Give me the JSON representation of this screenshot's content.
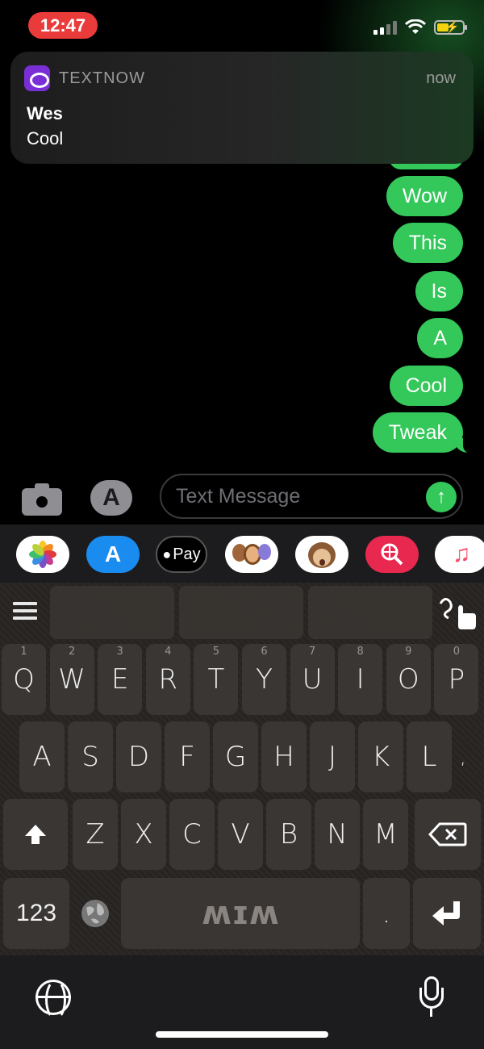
{
  "status_bar": {
    "time": "12:47"
  },
  "notification": {
    "app_name": "TEXTNOW",
    "time": "now",
    "title": "Wes",
    "body": "Cool",
    "app_icon_color": "#7a2fd6"
  },
  "messages": [
    {
      "text": "Wow"
    },
    {
      "text": "This"
    },
    {
      "text": "Is"
    },
    {
      "text": "A"
    },
    {
      "text": "Cool"
    },
    {
      "text": "Tweak"
    }
  ],
  "composer": {
    "placeholder": "Text Message",
    "send_icon": "arrow-up-icon",
    "accent_color": "#34c759"
  },
  "app_strip": [
    {
      "name": "photos-app",
      "label": "",
      "icon": "photos-flower-icon"
    },
    {
      "name": "app-store-app",
      "label": "",
      "icon": "app-store-icon"
    },
    {
      "name": "apple-pay-app",
      "label": "Pay",
      "icon": "apple-icon"
    },
    {
      "name": "memoji-stickers-app",
      "label": "",
      "icon": "memoji-icon"
    },
    {
      "name": "animoji-app",
      "label": "",
      "icon": "monkey-icon"
    },
    {
      "name": "images-search-app",
      "label": "",
      "icon": "globe-search-icon"
    },
    {
      "name": "music-app",
      "label": "",
      "icon": "music-note-icon"
    }
  ],
  "keyboard": {
    "row1": [
      {
        "key": "Q",
        "hint": "1"
      },
      {
        "key": "W",
        "hint": "2"
      },
      {
        "key": "E",
        "hint": "3"
      },
      {
        "key": "R",
        "hint": "4"
      },
      {
        "key": "T",
        "hint": "5"
      },
      {
        "key": "Y",
        "hint": "6"
      },
      {
        "key": "U",
        "hint": "7"
      },
      {
        "key": "I",
        "hint": "8"
      },
      {
        "key": "O",
        "hint": "9"
      },
      {
        "key": "P",
        "hint": "0"
      }
    ],
    "row2": [
      "A",
      "S",
      "D",
      "F",
      "G",
      "H",
      "J",
      "K",
      "L",
      ","
    ],
    "row3": [
      "Z",
      "X",
      "C",
      "V",
      "B",
      "N",
      "M"
    ],
    "numbers_label": "123",
    "period_label": ".",
    "space_logo": "ʍɪʍ"
  }
}
